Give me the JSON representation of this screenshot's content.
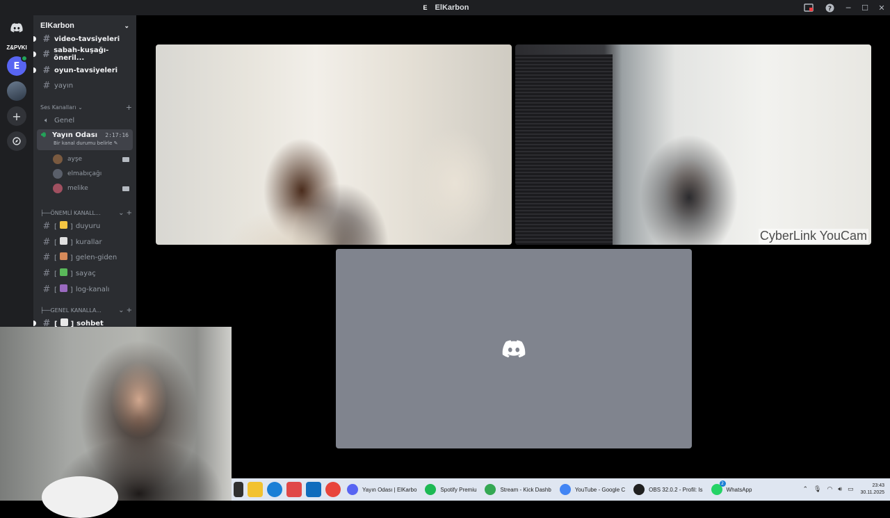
{
  "window": {
    "title": "ElKarbon",
    "badge": "E"
  },
  "rail": {
    "label_text": "Z&PVKI",
    "server_initial": "E"
  },
  "sidebar": {
    "server_name": "ElKarbon",
    "channels_top": [
      {
        "name": "video-tavsiyeleri",
        "unread": true
      },
      {
        "name": "sabah-kuşağı-öneril...",
        "unread": true
      },
      {
        "name": "oyun-tavsiyeleri",
        "unread": true
      },
      {
        "name": "yayın",
        "unread": false
      }
    ],
    "voice_category": "Ses Kanalları",
    "voice_channels": {
      "genel": "Genel",
      "active": {
        "name": "Yayın Odası",
        "time": "2:17:16",
        "status": "Bir kanal durumu belirle"
      }
    },
    "members": [
      {
        "name": "ayşe",
        "camera": true,
        "color": "#7a5a40"
      },
      {
        "name": "elmabıçağı",
        "camera": false,
        "color": "#5a5f6a"
      },
      {
        "name": "melike",
        "camera": true,
        "color": "#a05060"
      }
    ],
    "cat_important": "ÖNEMLİ KANALL...",
    "important_channels": [
      {
        "name": "duyuru",
        "emoji_color": "#f4c542"
      },
      {
        "name": "kurallar",
        "emoji_color": "#e0e0e0"
      },
      {
        "name": "gelen-giden",
        "emoji_color": "#d68a5a"
      },
      {
        "name": "sayaç",
        "emoji_color": "#5ab85a"
      },
      {
        "name": "log-kanalı",
        "emoji_color": "#9a6ac0"
      }
    ],
    "cat_general": "GENEL KANALLA...",
    "general_channels": [
      {
        "name": "sohbet",
        "unread": true
      }
    ]
  },
  "tiles": {
    "melike_watermark": "CyberLink YouCam"
  },
  "taskbar": {
    "apps": [
      {
        "label": "Yayın Odası | ElKarbo",
        "color": "#5865f2"
      },
      {
        "label": "Spotify Premiu",
        "color": "#1db954"
      },
      {
        "label": "Stream - Kick Dashb",
        "color": "#34a853"
      },
      {
        "label": "YouTube - Google C",
        "color": "#4285f4"
      },
      {
        "label": "OBS 32.0.2 - Profil: Is",
        "color": "#202020"
      },
      {
        "label": "WhatsApp",
        "color": "#25d366"
      }
    ],
    "whatsapp_badge": "2",
    "time": "23:43",
    "date": "30.11.2025"
  },
  "colors": {
    "accent": "#5865f2",
    "online": "#23a55a",
    "sidebar": "#2b2d31",
    "rail": "#1e1f22"
  }
}
